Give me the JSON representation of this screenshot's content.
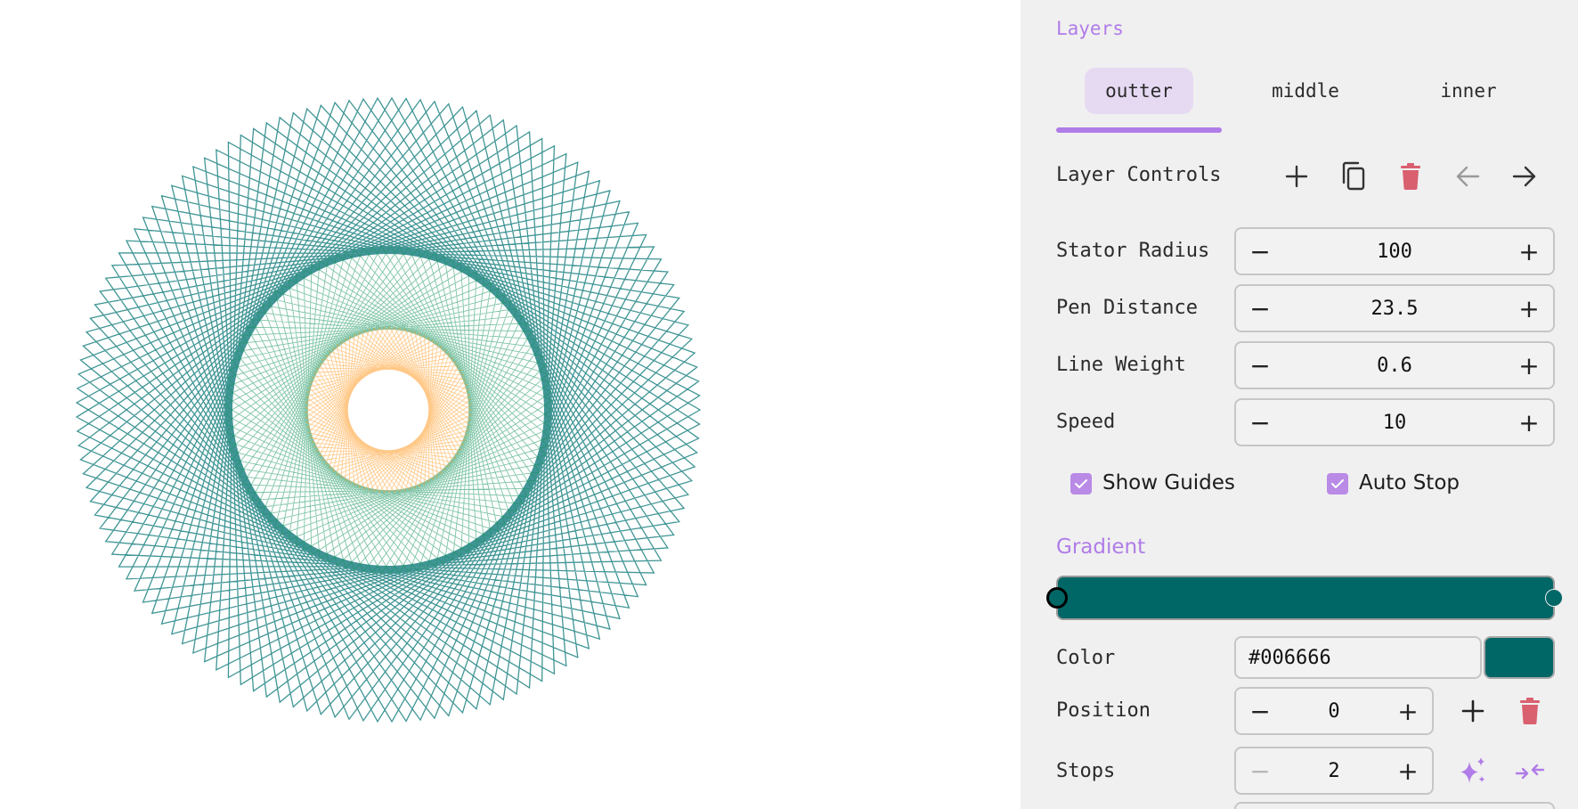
{
  "panel": {
    "layers_title": "Layers",
    "tabs": [
      {
        "label": "outter",
        "active": true
      },
      {
        "label": "middle",
        "active": false
      },
      {
        "label": "inner",
        "active": false
      }
    ],
    "layer_controls": {
      "label": "Layer Controls",
      "icons": [
        "add-icon",
        "copy-icon",
        "delete-icon",
        "arrow-left-icon",
        "arrow-right-icon"
      ]
    },
    "parameters": [
      {
        "name": "stator-radius",
        "label": "Stator Radius",
        "value": "100"
      },
      {
        "name": "pen-distance",
        "label": "Pen Distance",
        "value": "23.5"
      },
      {
        "name": "line-weight",
        "label": "Line Weight",
        "value": "0.6"
      },
      {
        "name": "speed",
        "label": "Speed",
        "value": "10"
      }
    ],
    "stepper_minus": "−",
    "stepper_plus": "+",
    "checkboxes": {
      "show_guides": {
        "label": "Show Guides",
        "checked": true
      },
      "auto_stop": {
        "label": "Auto Stop",
        "checked": true
      }
    },
    "gradient_title": "Gradient",
    "gradient": {
      "stops": [
        {
          "position": 0,
          "color": "#006666"
        },
        {
          "position": 1,
          "color": "#006666"
        }
      ]
    },
    "color": {
      "label": "Color",
      "value": "#006666"
    },
    "position": {
      "label": "Position",
      "value": "0"
    },
    "stops": {
      "label": "Stops",
      "value": "2"
    }
  },
  "colors": {
    "accent": "#b07ce8",
    "tab_active_bg": "#e6daf3",
    "delete": "#d9606f",
    "outer_layer": "#007272",
    "middle_layer": "#14935c",
    "inner_layer": "#ff9a24"
  }
}
